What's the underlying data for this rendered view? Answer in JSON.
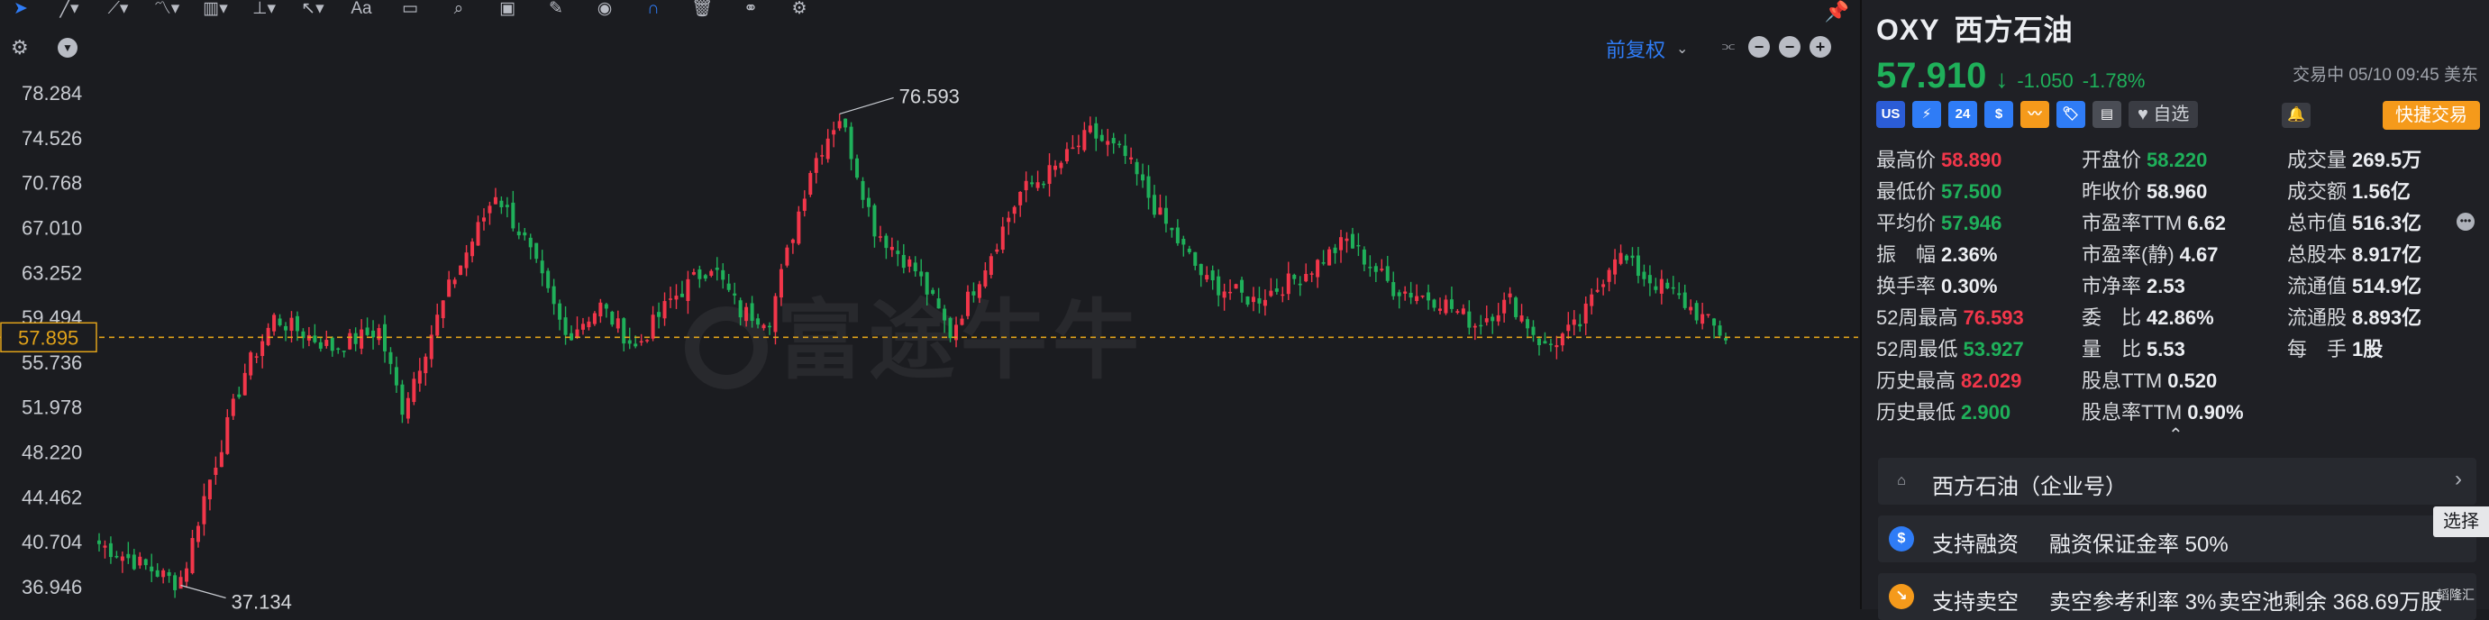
{
  "toolbar": {
    "adjust_label": "前复权",
    "tools": [
      "cursor",
      "line",
      "ray",
      "fib",
      "chart",
      "measure",
      "arrow",
      "text",
      "comment",
      "search",
      "screenshot",
      "pencil",
      "eye",
      "magnet",
      "trash",
      "link",
      "gear"
    ],
    "text_tool_label": "Aa"
  },
  "chart_data": {
    "type": "candlestick",
    "y_tick_labels": [
      "78.284",
      "74.526",
      "70.768",
      "67.010",
      "63.252",
      "59.494",
      "55.736",
      "51.978",
      "48.220",
      "44.462",
      "40.704",
      "36.946"
    ],
    "ylim": [
      36.946,
      78.284
    ],
    "current_price_label": "57.895",
    "current_price": 57.895,
    "high_annotation": "76.593",
    "high_value": 76.593,
    "low_annotation": "37.134",
    "low_value": 37.134,
    "anchors": [
      [
        0,
        40.6
      ],
      [
        10,
        38.2
      ],
      [
        14,
        37.134
      ],
      [
        18,
        44.5
      ],
      [
        25,
        55.0
      ],
      [
        30,
        59.5
      ],
      [
        40,
        57.0
      ],
      [
        48,
        58.5
      ],
      [
        52,
        52.0
      ],
      [
        60,
        62.0
      ],
      [
        68,
        70.0
      ],
      [
        73,
        66.0
      ],
      [
        80,
        58.0
      ],
      [
        86,
        60.5
      ],
      [
        92,
        57.0
      ],
      [
        98,
        61.0
      ],
      [
        105,
        64.0
      ],
      [
        110,
        60.0
      ],
      [
        115,
        59.5
      ],
      [
        122,
        72.0
      ],
      [
        127,
        76.593
      ],
      [
        133,
        67.0
      ],
      [
        140,
        63.5
      ],
      [
        146,
        58.2
      ],
      [
        152,
        64.0
      ],
      [
        158,
        70.0
      ],
      [
        164,
        72.0
      ],
      [
        170,
        75.0
      ],
      [
        176,
        73.0
      ],
      [
        182,
        68.0
      ],
      [
        190,
        62.5
      ],
      [
        198,
        61.0
      ],
      [
        206,
        63.0
      ],
      [
        214,
        66.0
      ],
      [
        222,
        62.0
      ],
      [
        230,
        61.0
      ],
      [
        236,
        59.0
      ],
      [
        242,
        61.0
      ],
      [
        248,
        57.0
      ],
      [
        254,
        59.0
      ],
      [
        260,
        65.0
      ],
      [
        265,
        63.0
      ],
      [
        270,
        61.5
      ],
      [
        275,
        59.5
      ],
      [
        279,
        57.9
      ]
    ]
  },
  "watermark": "富途牛牛",
  "quote": {
    "symbol": "OXY",
    "name": "西方石油",
    "price": "57.910",
    "change": "-1.050",
    "change_pct": "-1.78%",
    "status": "交易中 05/10 09:45 美东",
    "watch_label": "自选",
    "quick_trade_label": "快捷交易",
    "badges": [
      {
        "name": "us-flag-icon",
        "text": "US",
        "color": "#2b5cd6"
      },
      {
        "name": "lightning-icon",
        "text": "⚡",
        "color": "#2f7cf6"
      },
      {
        "name": "hours-24-icon",
        "text": "24",
        "color": "#2f7cf6"
      },
      {
        "name": "dollar-icon",
        "text": "$",
        "color": "#2f7cf6"
      },
      {
        "name": "trend-icon",
        "text": "〰",
        "color": "#f59a1b"
      },
      {
        "name": "tag-icon",
        "text": "🏷",
        "color": "#2f7cf6"
      },
      {
        "name": "doc-icon",
        "text": "▤",
        "color": "#4a4d55"
      }
    ],
    "stats": [
      [
        {
          "label": "最高价",
          "value": "58.890",
          "cls": "up"
        },
        {
          "label": "开盘价",
          "value": "58.220",
          "cls": "down"
        },
        {
          "label": "成交量",
          "value": "269.5万",
          "cls": "neutral"
        }
      ],
      [
        {
          "label": "最低价",
          "value": "57.500",
          "cls": "down"
        },
        {
          "label": "昨收价",
          "value": "58.960",
          "cls": "neutral"
        },
        {
          "label": "成交额",
          "value": "1.56亿",
          "cls": "neutral"
        }
      ],
      [
        {
          "label": "平均价",
          "value": "57.946",
          "cls": "down"
        },
        {
          "label": "市盈率TTM",
          "value": "6.62",
          "cls": "neutral"
        },
        {
          "label": "总市值",
          "value": "516.3亿",
          "cls": "neutral"
        }
      ],
      [
        {
          "label": "振　幅",
          "value": "2.36%",
          "cls": "neutral"
        },
        {
          "label": "市盈率(静)",
          "value": "4.67",
          "cls": "neutral"
        },
        {
          "label": "总股本",
          "value": "8.917亿",
          "cls": "neutral"
        }
      ],
      [
        {
          "label": "换手率",
          "value": "0.30%",
          "cls": "neutral"
        },
        {
          "label": "市净率",
          "value": "2.53",
          "cls": "neutral"
        },
        {
          "label": "流通值",
          "value": "514.9亿",
          "cls": "neutral"
        }
      ],
      [
        {
          "label": "52周最高",
          "value": "76.593",
          "cls": "up"
        },
        {
          "label": "委　比",
          "value": "42.86%",
          "cls": "neutral"
        },
        {
          "label": "流通股",
          "value": "8.893亿",
          "cls": "neutral"
        }
      ],
      [
        {
          "label": "52周最低",
          "value": "53.927",
          "cls": "down"
        },
        {
          "label": "量　比",
          "value": "5.53",
          "cls": "neutral"
        },
        {
          "label": "每　手",
          "value": "1股",
          "cls": "neutral"
        }
      ],
      [
        {
          "label": "历史最高",
          "value": "82.029",
          "cls": "up"
        },
        {
          "label": "股息TTM",
          "value": "0.520",
          "cls": "neutral"
        },
        null
      ],
      [
        {
          "label": "历史最低",
          "value": "2.900",
          "cls": "down"
        },
        {
          "label": "股息率TTM",
          "value": "0.90%",
          "cls": "neutral"
        },
        null
      ]
    ],
    "company_row": "西方石油（企业号）",
    "margin_row": {
      "t1": "支持融资",
      "t2": "融资保证金率 50%"
    },
    "short_row": {
      "t1": "支持卖空",
      "t2": "卖空参考利率 3%",
      "t3": "卖空池剩余 368.69万股"
    },
    "select_tip": "选择",
    "brand_small": "韬隆汇"
  },
  "colors": {
    "up": "#f2364a",
    "down": "#1fb05a",
    "accent": "#2f7cf6",
    "price_line": "#e0a21a",
    "quick_trade": "#f59a1b"
  }
}
